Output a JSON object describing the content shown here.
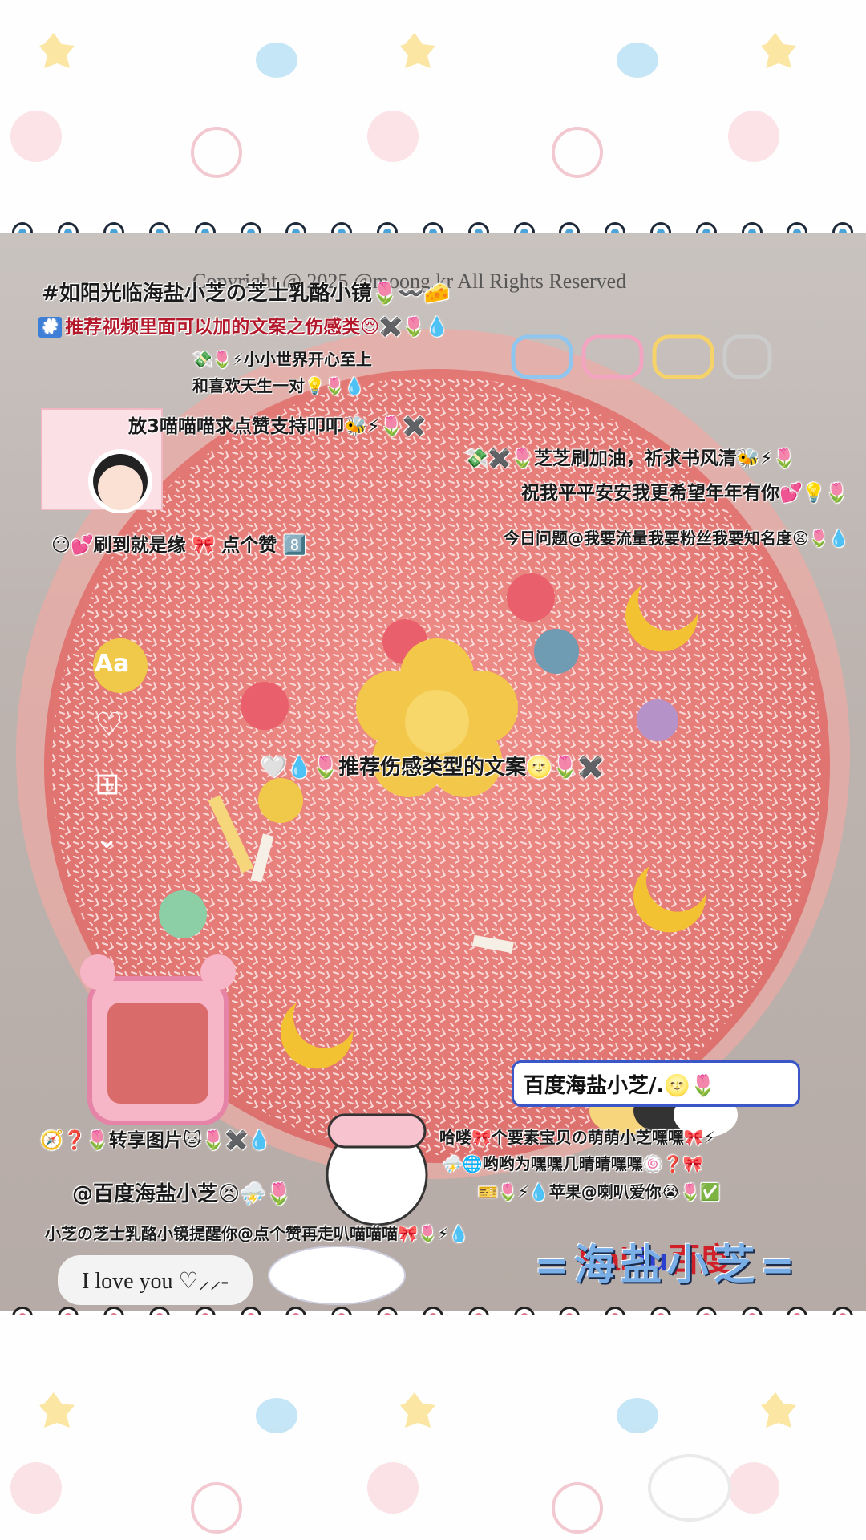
{
  "copyright": "Copyright @ 2025 @moong.kr All Rights Reserved",
  "overlays": {
    "title_line": "#如阳光临海盐小芝の芝士乳酪小镜🌷〰️🧀",
    "line2": "推荐视频里面可以加的文案之伤感类😌✖️🌷💧",
    "line3": "💸🌷⚡小小世界开心至上",
    "line4": "和喜欢天生一对💡🌷💧",
    "line5": "放3喵喵喵求点赞支持叩叩🐝⚡🌷✖️",
    "line6": "💸✖️🌷芝芝刷加油，祈求书风清🐝⚡🌷",
    "line7": "祝我平平安安我更希望年年有你💕💡🌷",
    "line8": "今日问题@我要流量我要粉丝我要知名度😫🌷💧",
    "line9": "😶💕刷到就是缘 🎀 点个赞 8️⃣",
    "center_line": "🤍💧🌷推荐伤感类型的文案🌝🌷✖️",
    "share_line": "🧭❓🌷转享图片🐱🌷✖️💧",
    "at_line": "@百度海盐小芝😣⛈️🌷",
    "bottom_line": "小芝の芝士乳酪小镜提醒你@点个赞再走叭喵喵喵🎀🌷⚡💧",
    "right_a": "哈喽🎀个要素宝贝の萌萌小芝嘿嘿🎀⚡",
    "right_b": "⛈️🌐哟哟为嘿嘿几晴晴嘿嘿🍥❓🎀",
    "right_c": "🎫🌷⚡💧苹果@喇叭爱你😭🌷✅",
    "haiyan": "=海盐小芝="
  },
  "pill_text": "I love you ♡⸝⸝-",
  "baidu": {
    "logo_left": "Bai",
    "logo_paw": "du",
    "logo_right": "百度",
    "search_text": "百度海盐小芝/.🌝🌷"
  },
  "side_icons": {
    "text_button": "Aa",
    "heart": "♡",
    "layout": "⊞",
    "chevron": "⌄"
  },
  "colors": {
    "cake": "#e8837e",
    "red_text": "#b3182b",
    "baidu_blue": "#3b56c6",
    "baidu_red": "#d0202a"
  }
}
